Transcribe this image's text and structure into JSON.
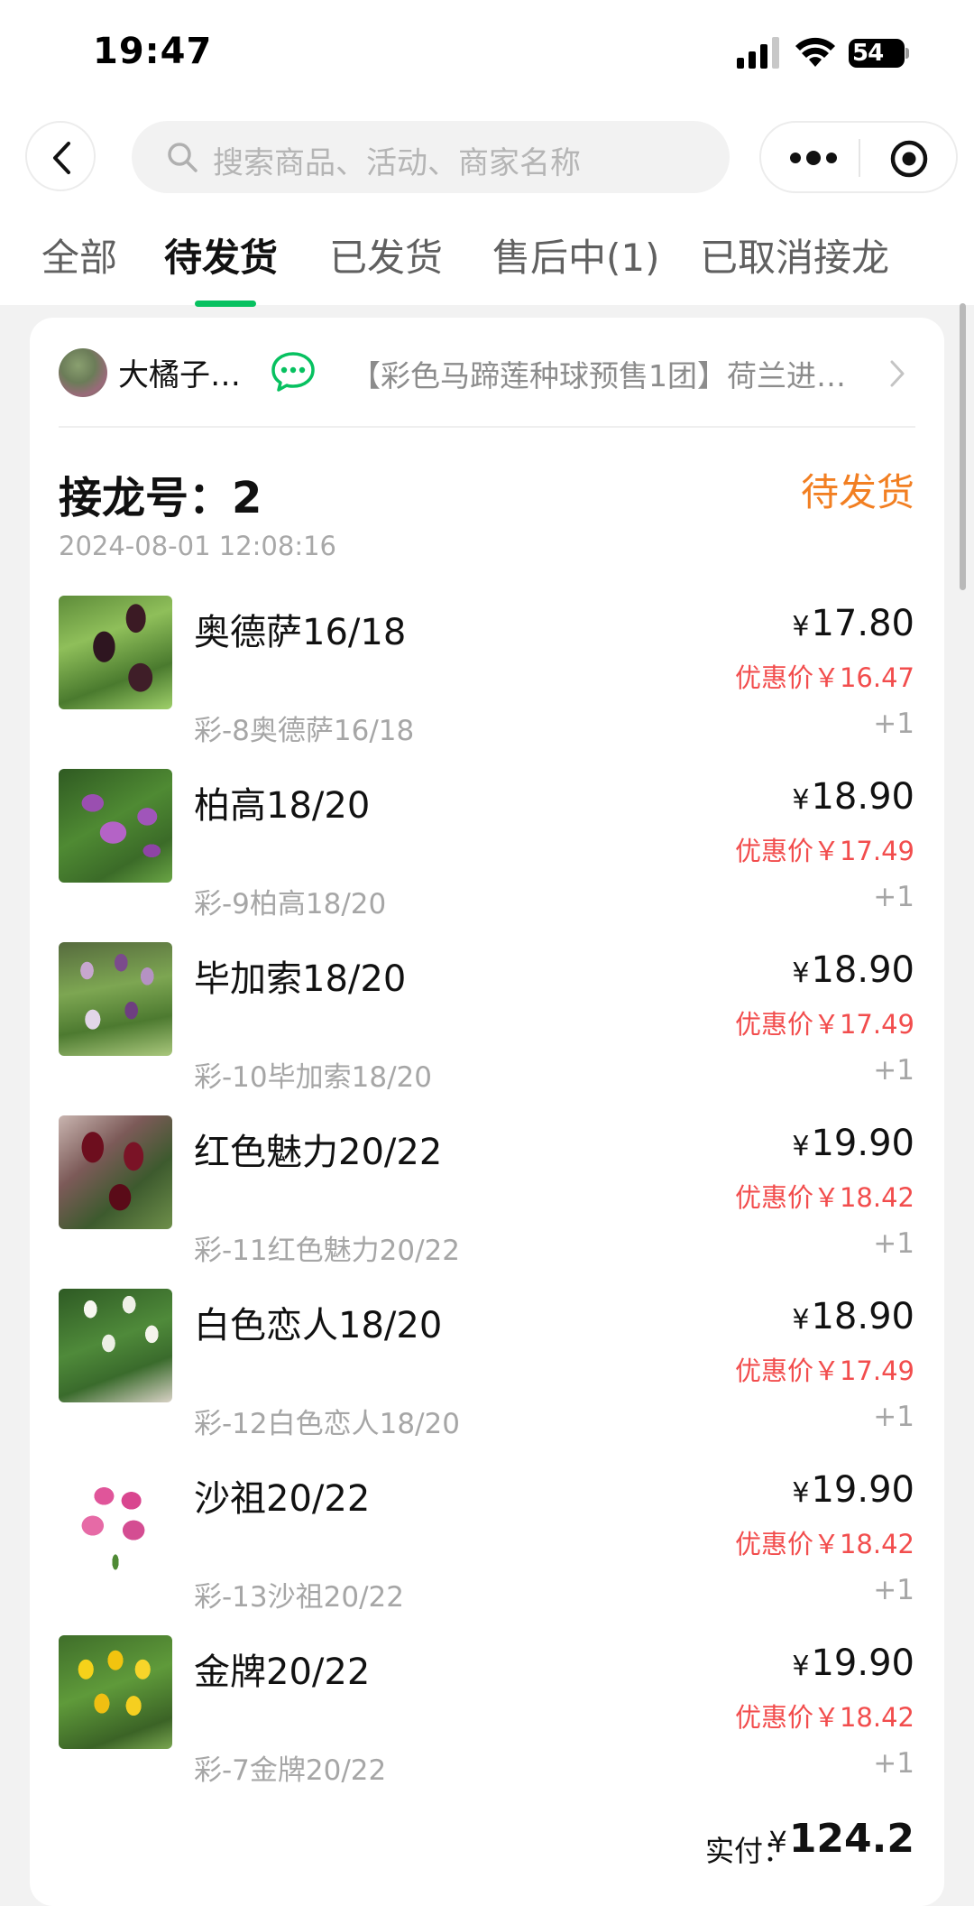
{
  "status_bar": {
    "time": "19:47",
    "battery": "54"
  },
  "nav": {
    "search_placeholder": "搜索商品、活动、商家名称"
  },
  "tabs": [
    {
      "label": "全部",
      "active": false
    },
    {
      "label": "待发货",
      "active": true
    },
    {
      "label": "已发货",
      "active": false
    },
    {
      "label": "售后中(1)",
      "active": false
    },
    {
      "label": "已取消接龙",
      "active": false
    }
  ],
  "order": {
    "shop_name": "大橘子…",
    "group_title": "【彩色马蹄莲种球预售1团】荷兰进…",
    "number_label": "接龙号：",
    "number_value": "2",
    "status": "待发货",
    "time": "2024-08-01 12:08:16",
    "items": [
      {
        "name": "奥德萨16/18",
        "currency": "¥",
        "price": "17.80",
        "discount": "优惠价￥16.47",
        "spec": "彩-8奥德萨16/18",
        "qty": "+1",
        "image": "dark-calla-lily"
      },
      {
        "name": "柏高18/20",
        "currency": "¥",
        "price": "18.90",
        "discount": "优惠价￥17.49",
        "spec": "彩-9柏高18/20",
        "qty": "+1",
        "image": "purple-calla-lily"
      },
      {
        "name": "毕加索18/20",
        "currency": "¥",
        "price": "18.90",
        "discount": "优惠价￥17.49",
        "spec": "彩-10毕加索18/20",
        "qty": "+1",
        "image": "picasso-calla-lily"
      },
      {
        "name": "红色魅力20/22",
        "currency": "¥",
        "price": "19.90",
        "discount": "优惠价￥18.42",
        "spec": "彩-11红色魅力20/22",
        "qty": "+1",
        "image": "red-calla-lily"
      },
      {
        "name": "白色恋人18/20",
        "currency": "¥",
        "price": "18.90",
        "discount": "优惠价￥17.49",
        "spec": "彩-12白色恋人18/20",
        "qty": "+1",
        "image": "white-calla-lily"
      },
      {
        "name": "沙祖20/22",
        "currency": "¥",
        "price": "19.90",
        "discount": "优惠价￥18.42",
        "spec": "彩-13沙祖20/22",
        "qty": "+1",
        "image": "pink-calla-lily"
      },
      {
        "name": "金牌20/22",
        "currency": "¥",
        "price": "19.90",
        "discount": "优惠价￥18.42",
        "spec": "彩-7金牌20/22",
        "qty": "+1",
        "image": "yellow-calla-lily"
      }
    ],
    "total_label": "实付：",
    "total_currency": "¥",
    "total_value": "124.2"
  },
  "colors": {
    "accent_green": "#07c160",
    "status_orange": "#f27f22",
    "discount_red": "#f24d4d"
  },
  "icons": [
    "back-icon",
    "search-icon",
    "more-icon",
    "target-icon",
    "chat-icon",
    "chevron-right-icon"
  ]
}
